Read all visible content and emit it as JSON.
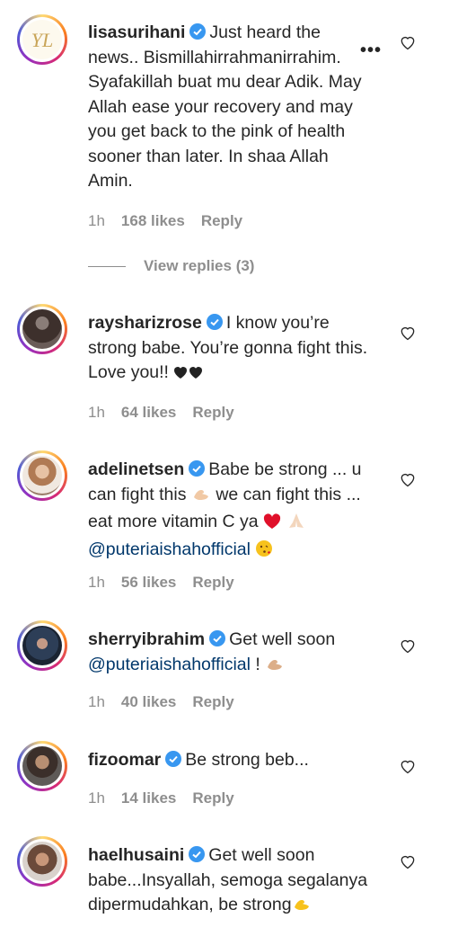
{
  "comments": [
    {
      "username": "lisasurihani",
      "text": "Just heard the news.. Bismillahirrahmanirrahim. Syafakillah buat mu dear Adik. May Allah ease your recovery and may you get back to the pink of health sooner than later. In shaa Allah Amin.",
      "time": "1h",
      "likes": "168 likes",
      "reply": "Reply",
      "view_replies": "View replies (3)"
    },
    {
      "username": "rayshariz rose",
      "text": "I know you’re strong babe. You’re gonna fight this. Love you!!",
      "time": "1h",
      "likes": "64 likes",
      "reply": "Reply"
    },
    {
      "username": "adelinetsen",
      "text_1": "Babe be strong ... u can fight this",
      "text_2": "we can fight this ... eat more vitamin C ya",
      "mention": "@puteriaishahofficial",
      "time": "1h",
      "likes": "56 likes",
      "reply": "Reply"
    },
    {
      "username": "sherryibrahim",
      "text": "Get well soon",
      "mention": "@puteriaishahofficial",
      "suffix": "!",
      "time": "1h",
      "likes": "40 likes",
      "reply": "Reply"
    },
    {
      "username": "fizoomar",
      "text": "Be strong beb...",
      "time": "1h",
      "likes": "14 likes",
      "reply": "Reply"
    },
    {
      "username": "haelhusaini",
      "text": "Get well soon babe...Insyallah, semoga segalanya dipermudahkan, be strong",
      "time": "",
      "likes": "",
      "reply": ""
    }
  ],
  "more_icon": "•••",
  "icons": {
    "heart": "heart-outline-icon",
    "verified": "verified-badge-icon",
    "more": "more-options-icon"
  },
  "colors": {
    "verified": "#3897f0",
    "meta": "#8e8e8e",
    "mention": "#00376b"
  }
}
